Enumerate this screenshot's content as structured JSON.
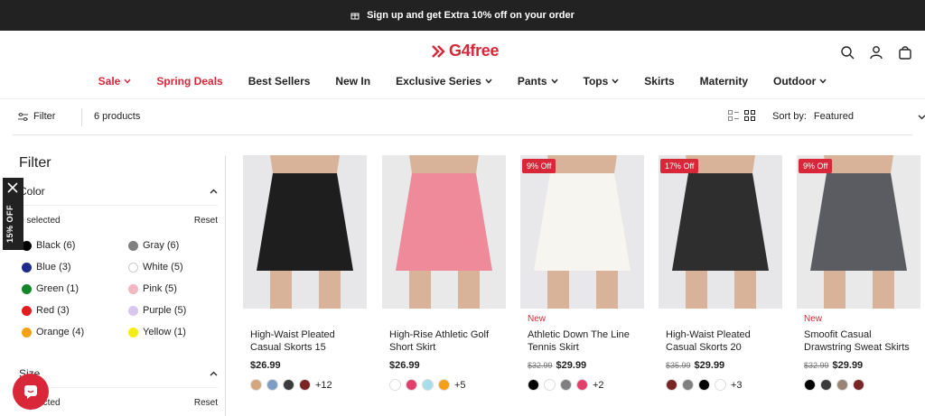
{
  "announcement": {
    "text": "Sign up and get Extra 10% off on your order"
  },
  "brand": {
    "name": "G4free",
    "accent": "#d9273a"
  },
  "nav": [
    {
      "label": "Sale",
      "chevron": true,
      "red": true
    },
    {
      "label": "Spring Deals",
      "chevron": false,
      "red": true
    },
    {
      "label": "Best Sellers",
      "chevron": false,
      "red": false
    },
    {
      "label": "New In",
      "chevron": false,
      "red": false
    },
    {
      "label": "Exclusive Series",
      "chevron": true,
      "red": false
    },
    {
      "label": "Pants",
      "chevron": true,
      "red": false
    },
    {
      "label": "Tops",
      "chevron": true,
      "red": false
    },
    {
      "label": "Skirts",
      "chevron": false,
      "red": false
    },
    {
      "label": "Maternity",
      "chevron": false,
      "red": false
    },
    {
      "label": "Outdoor",
      "chevron": true,
      "red": false
    }
  ],
  "toolbar": {
    "filter_label": "Filter",
    "count": "6 products",
    "sort_label": "Sort by:",
    "sort_value": "Featured"
  },
  "sidebar": {
    "title": "Filter",
    "color_group": "Color",
    "selected": "0 selected",
    "reset": "Reset",
    "colors": [
      {
        "label": "Black (6)",
        "hex": "#000000"
      },
      {
        "label": "Gray (6)",
        "hex": "#808080"
      },
      {
        "label": "Blue (3)",
        "hex": "#1f2a8a"
      },
      {
        "label": "White (5)",
        "hex": "#ffffff"
      },
      {
        "label": "Green (1)",
        "hex": "#14852b"
      },
      {
        "label": "Pink (5)",
        "hex": "#f4b6c0"
      },
      {
        "label": "Red (3)",
        "hex": "#e0201f"
      },
      {
        "label": "Purple (5)",
        "hex": "#d9c6ee"
      },
      {
        "label": "Orange (4)",
        "hex": "#f3a015"
      },
      {
        "label": "Yellow (1)",
        "hex": "#f5ec16"
      }
    ],
    "size_group": "Size",
    "size_selected": "0 selected",
    "size_reset": "Reset"
  },
  "promo_tab": {
    "text": "15% OFF"
  },
  "products": [
    {
      "badge": "",
      "new": "",
      "name": "High-Waist Pleated Casual Skorts 15",
      "old_price": "",
      "price": "$26.99",
      "swatches": [
        "#d4a67e",
        "#7e9cc6",
        "#3b3b3b",
        "#7a2525"
      ],
      "more": "+12",
      "img_bg": "#e7e7e9",
      "garment": "#1e1e1e"
    },
    {
      "badge": "",
      "new": "",
      "name": "High-Rise Athletic Golf Short Skirt",
      "old_price": "",
      "price": "$26.99",
      "swatches": [
        "#ffffff",
        "#e0406a",
        "#a9dde9",
        "#f3a015"
      ],
      "more": "+5",
      "img_bg": "#e9e9ea",
      "garment": "#ee8a99"
    },
    {
      "badge": "9% Off",
      "new": "New",
      "name": "Athletic Down The Line Tennis Skirt",
      "old_price": "$32.99",
      "price": "$29.99",
      "swatches": [
        "#000000",
        "#ffffff",
        "#808080",
        "#e0406a"
      ],
      "more": "+2",
      "img_bg": "#e8e8ea",
      "garment": "#f7f5ef"
    },
    {
      "badge": "17% Off",
      "new": "",
      "name": "High-Waist Pleated Casual Skorts 20",
      "old_price": "$35.99",
      "price": "$29.99",
      "swatches": [
        "#7a2525",
        "#808080",
        "#000000",
        "#ffffff"
      ],
      "more": "+3",
      "img_bg": "#e7e7e9",
      "garment": "#2e2e2e"
    },
    {
      "badge": "9% Off",
      "new": "New",
      "name": "Smoofit Casual Drawstring Sweat Skirts",
      "old_price": "$32.99",
      "price": "$29.99",
      "swatches": [
        "#000000",
        "#3b3b3b",
        "#9a8478",
        "#7a2525"
      ],
      "more": "",
      "img_bg": "#e9e9ea",
      "garment": "#5a5c62"
    }
  ]
}
